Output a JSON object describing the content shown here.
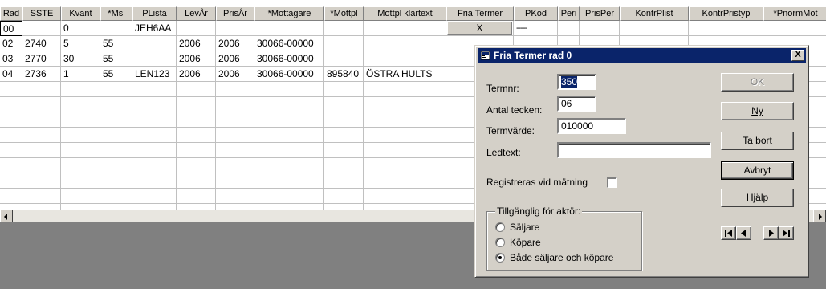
{
  "grid": {
    "columns": [
      {
        "label": "Rad",
        "w": 28
      },
      {
        "label": "SSTE",
        "w": 48
      },
      {
        "label": "Kvant",
        "w": 49
      },
      {
        "label": "*Msl",
        "w": 40
      },
      {
        "label": "PLista",
        "w": 55
      },
      {
        "label": "LevÅr",
        "w": 49
      },
      {
        "label": "PrisÅr",
        "w": 48
      },
      {
        "label": "*Mottagare",
        "w": 87
      },
      {
        "label": "*Mottpl",
        "w": 49
      },
      {
        "label": "Mottpl klartext",
        "w": 103
      },
      {
        "label": "Fria Termer",
        "w": 84
      },
      {
        "label": "PKod",
        "w": 55
      },
      {
        "label": "Peri",
        "w": 27
      },
      {
        "label": "PrisPer",
        "w": 50
      },
      {
        "label": "KontrPlist",
        "w": 86
      },
      {
        "label": "KontrPristyp",
        "w": 93
      },
      {
        "label": "*PnormMot",
        "w": 80
      }
    ],
    "rows": [
      [
        "00",
        "",
        "0",
        "",
        "JEH6AA",
        "",
        "",
        "",
        "",
        "",
        "X",
        "-----",
        "",
        "",
        "",
        "",
        ""
      ],
      [
        "02",
        "2740",
        "5",
        "55",
        "",
        "2006",
        "2006",
        "30066-00000",
        "",
        "",
        "",
        "",
        "",
        "",
        "",
        "",
        ""
      ],
      [
        "03",
        "2770",
        "30",
        "55",
        "",
        "2006",
        "2006",
        "30066-00000",
        "",
        "",
        "",
        "",
        "",
        "",
        "",
        "",
        ""
      ],
      [
        "04",
        "2736",
        "1",
        "55",
        "LEN123",
        "2006",
        "2006",
        "30066-00000",
        "895840",
        "ÖSTRA HULTS",
        "",
        "",
        "",
        "",
        "",
        "",
        ""
      ]
    ]
  },
  "dialog": {
    "title": "Fria Termer rad 0",
    "close_label": "X",
    "fields": {
      "termnr_label": "Termnr:",
      "termnr_value": "350",
      "antal_label": "Antal tecken:",
      "antal_value": "06",
      "termvarde_label": "Termvärde:",
      "termvarde_value": "010000",
      "ledtext_label": "Ledtext:",
      "ledtext_value": ""
    },
    "registreras_label": "Registreras vid mätning",
    "registreras_checked": false,
    "buttons": {
      "ok": "OK",
      "ny": "Ny",
      "ta_bort": "Ta bort",
      "avbryt": "Avbryt",
      "hjalp": "Hjälp"
    },
    "group": {
      "title": "Tillgänglig för aktör:",
      "options": [
        "Säljare",
        "Köpare",
        "Både säljare och köpare"
      ],
      "selected": 2
    },
    "nav": [
      "first-record-icon",
      "prev-record-icon",
      "next-record-icon",
      "last-record-icon"
    ]
  },
  "colors": {
    "titlebar": "#0a246a",
    "face": "#d4d0c8",
    "workspace": "#808080"
  }
}
